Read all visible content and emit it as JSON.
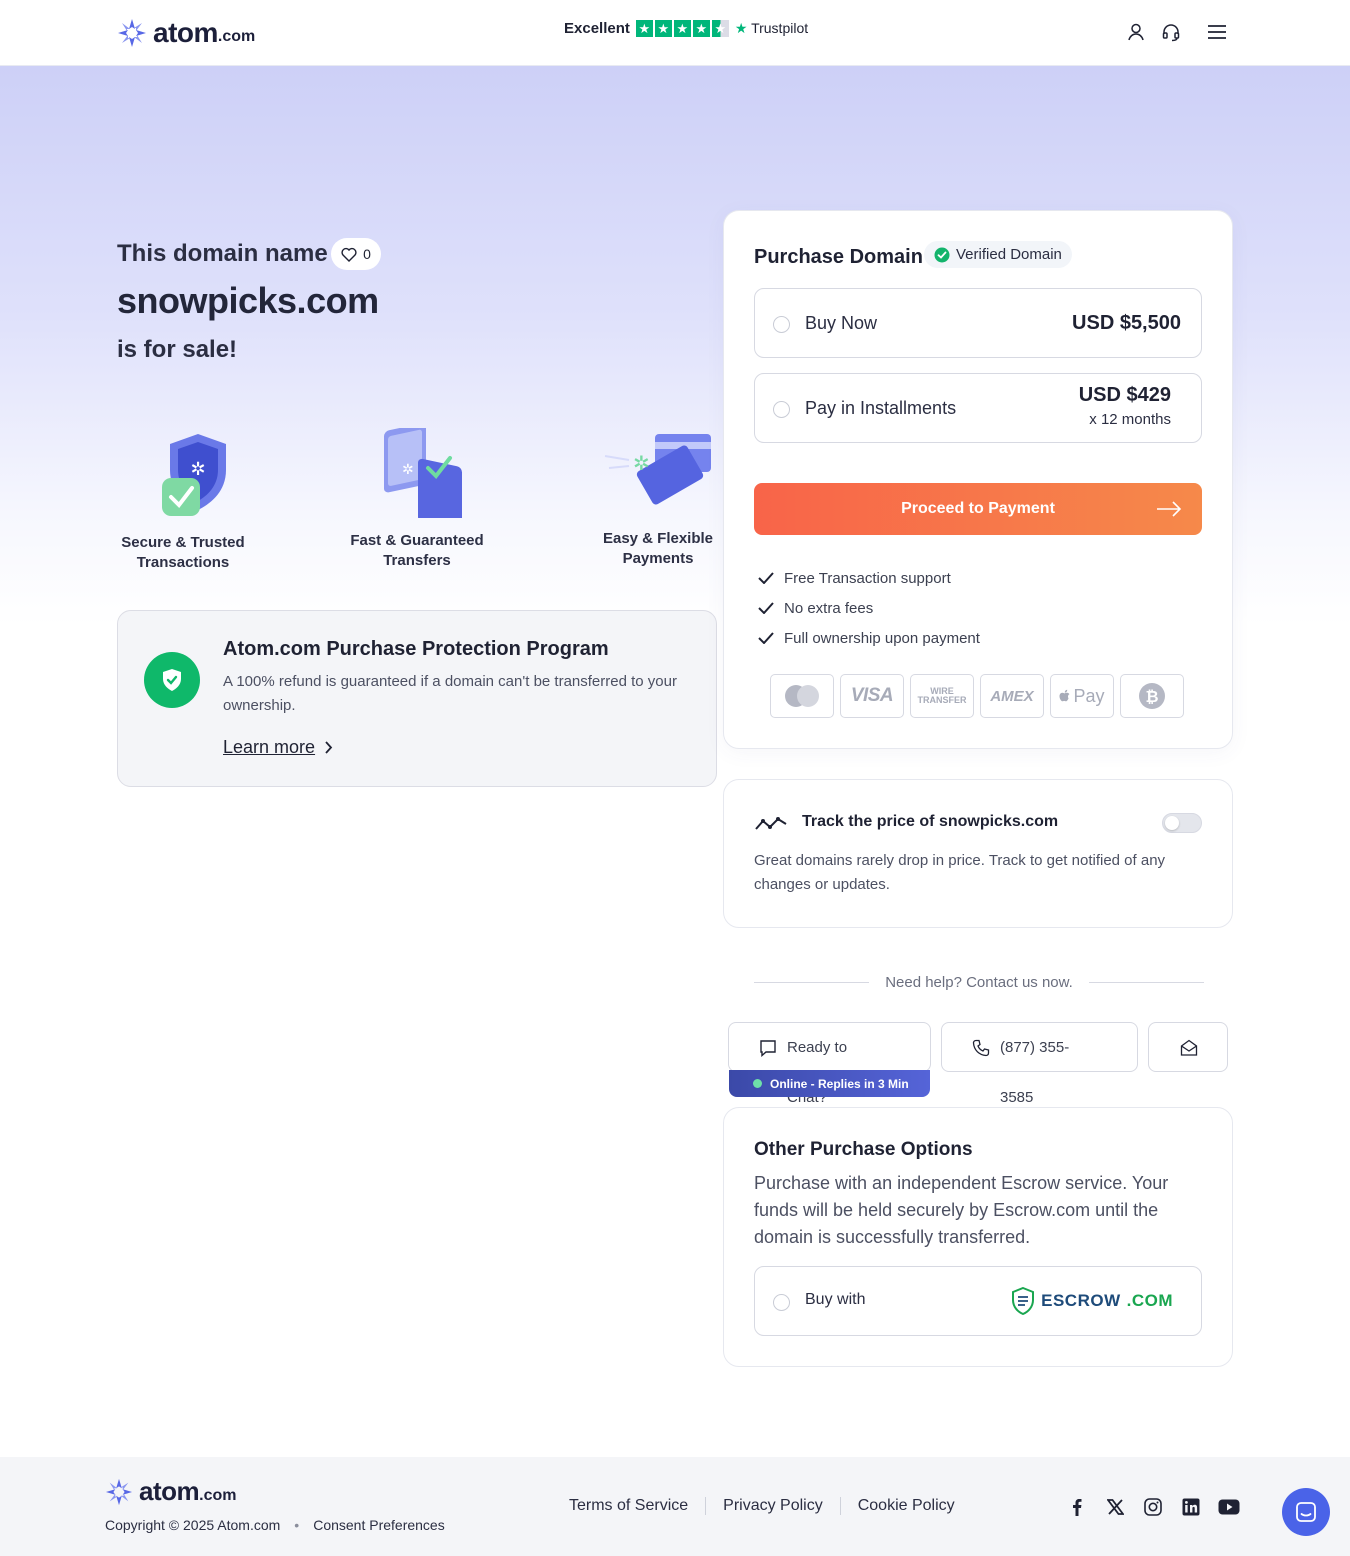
{
  "header": {
    "logo_word": "atom",
    "logo_suffix": ".com",
    "trust_rating_label": "Excellent",
    "trust_stars": 4.5,
    "trust_brand": "Trustpilot",
    "icons": [
      "user-icon",
      "headset-icon",
      "menu-icon"
    ]
  },
  "hero": {
    "line1": "This domain name",
    "likes": "0",
    "domain": "snowpicks.com",
    "line3": "is for sale!",
    "features": [
      {
        "label1": "Secure & Trusted",
        "label2": "Transactions"
      },
      {
        "label1": "Fast & Guaranteed",
        "label2": "Transfers"
      },
      {
        "label1": "Easy & Flexible",
        "label2": "Payments"
      }
    ]
  },
  "protection": {
    "title": "Atom.com Purchase Protection Program",
    "desc": "A 100% refund is guaranteed if a domain can't be transferred to your ownership.",
    "link": "Learn more"
  },
  "purchase": {
    "title": "Purchase Domain",
    "verified": "Verified Domain",
    "buy_now_label": "Buy Now",
    "buy_now_price": "USD $5,500",
    "install_label": "Pay in Installments",
    "install_price": "USD $429",
    "install_term": "x 12 months",
    "proceed": "Proceed to Payment",
    "checks": [
      "Free Transaction support",
      "No extra fees",
      "Full ownership upon payment"
    ],
    "payment_methods": [
      "mastercard",
      "VISA",
      "WIRE TRANSFER",
      "AMEX",
      "Pay",
      "bitcoin"
    ],
    "accent_color": "#f86449"
  },
  "track": {
    "title": "Track the price of snowpicks.com",
    "desc": "Great domains rarely drop in price. Track to get notified of any changes or updates."
  },
  "help": {
    "label": "Need help? Contact us now.",
    "chat": "Ready to Chat?",
    "online": "Online - Replies in 3 Min",
    "phone": "(877) 355-3585"
  },
  "other": {
    "title": "Other Purchase Options",
    "desc": "Purchase with an independent Escrow service. Your funds will be held securely by Escrow.com until the domain is successfully transferred.",
    "buy_with": "Buy with",
    "escrow_name": "ESCROW",
    "escrow_suffix": ".COM"
  },
  "footer": {
    "copyright": "Copyright © 2025 Atom.com",
    "consent": "Consent Preferences",
    "links": [
      "Terms of Service",
      "Privacy Policy",
      "Cookie Policy"
    ],
    "socials": [
      "facebook-icon",
      "x-icon",
      "instagram-icon",
      "linkedin-icon",
      "youtube-icon"
    ]
  }
}
